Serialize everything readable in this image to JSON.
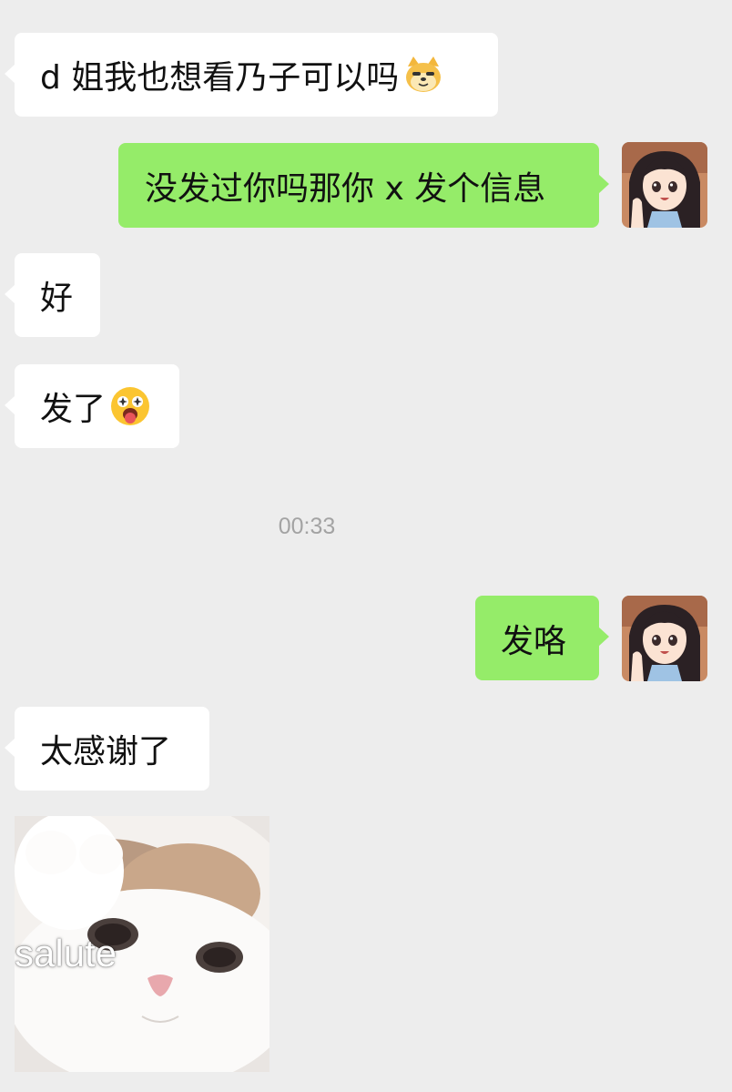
{
  "chat": {
    "messages": [
      {
        "direction": "in",
        "text": "d 姐我也想看乃子可以吗",
        "emoji": "doge-cat-emoji"
      },
      {
        "direction": "out",
        "text": "没发过你吗那你 x 发个信息"
      },
      {
        "direction": "in",
        "text": "好"
      },
      {
        "direction": "in",
        "text": "发了",
        "emoji": "starstruck-tongue-emoji"
      },
      {
        "direction": "out",
        "text": "发咯"
      },
      {
        "direction": "in",
        "text": "太感谢了"
      }
    ],
    "timestamp": "00:33",
    "sticker": {
      "label": "salute",
      "icon": "cat-salute-sticker"
    }
  },
  "colors": {
    "background": "#ededed",
    "incoming_bubble": "#ffffff",
    "outgoing_bubble": "#95ec69",
    "timestamp_text": "#a3a3a3"
  }
}
